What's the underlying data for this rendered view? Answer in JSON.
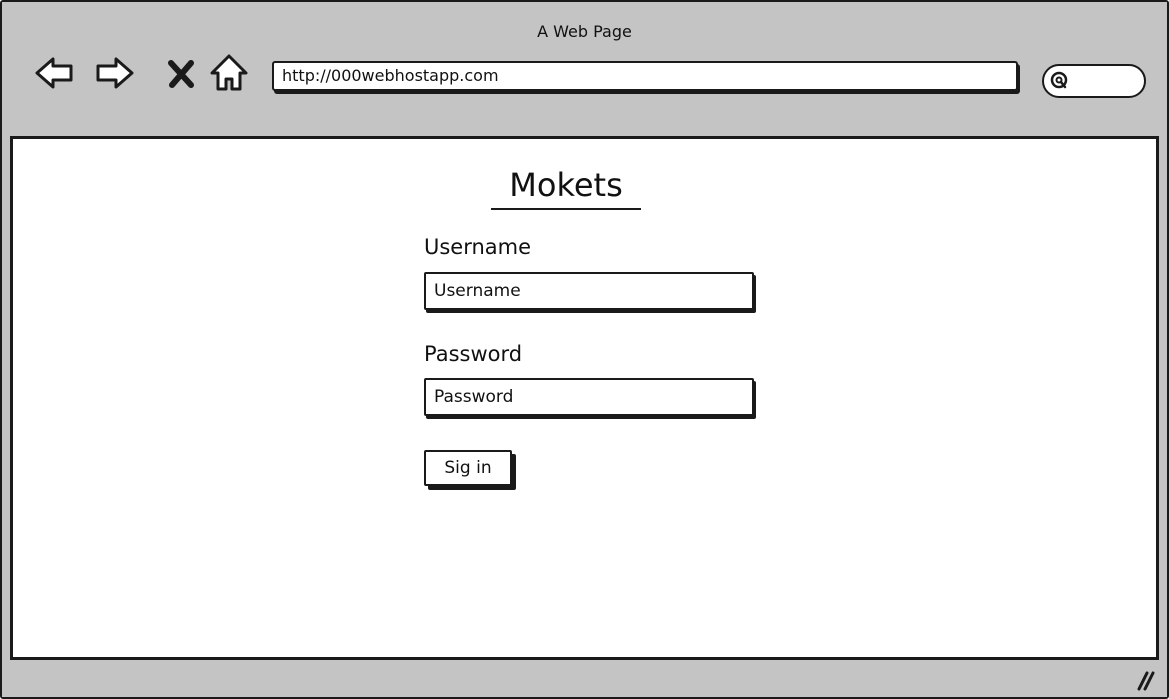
{
  "window": {
    "title": "A Web Page"
  },
  "toolbar": {
    "back_icon": "arrow-left-icon",
    "forward_icon": "arrow-right-icon",
    "stop_icon": "close-icon",
    "home_icon": "home-icon",
    "url": "http://000webhostapp.com",
    "search_icon": "search-icon"
  },
  "page": {
    "heading": "Mokets",
    "username": {
      "label": "Username",
      "placeholder": "Username"
    },
    "password": {
      "label": "Password",
      "placeholder": "Password"
    },
    "signin_label": "Sig in"
  },
  "colors": {
    "chrome": "#c4c4c4",
    "ink": "#1a1a1a",
    "surface": "#ffffff"
  }
}
